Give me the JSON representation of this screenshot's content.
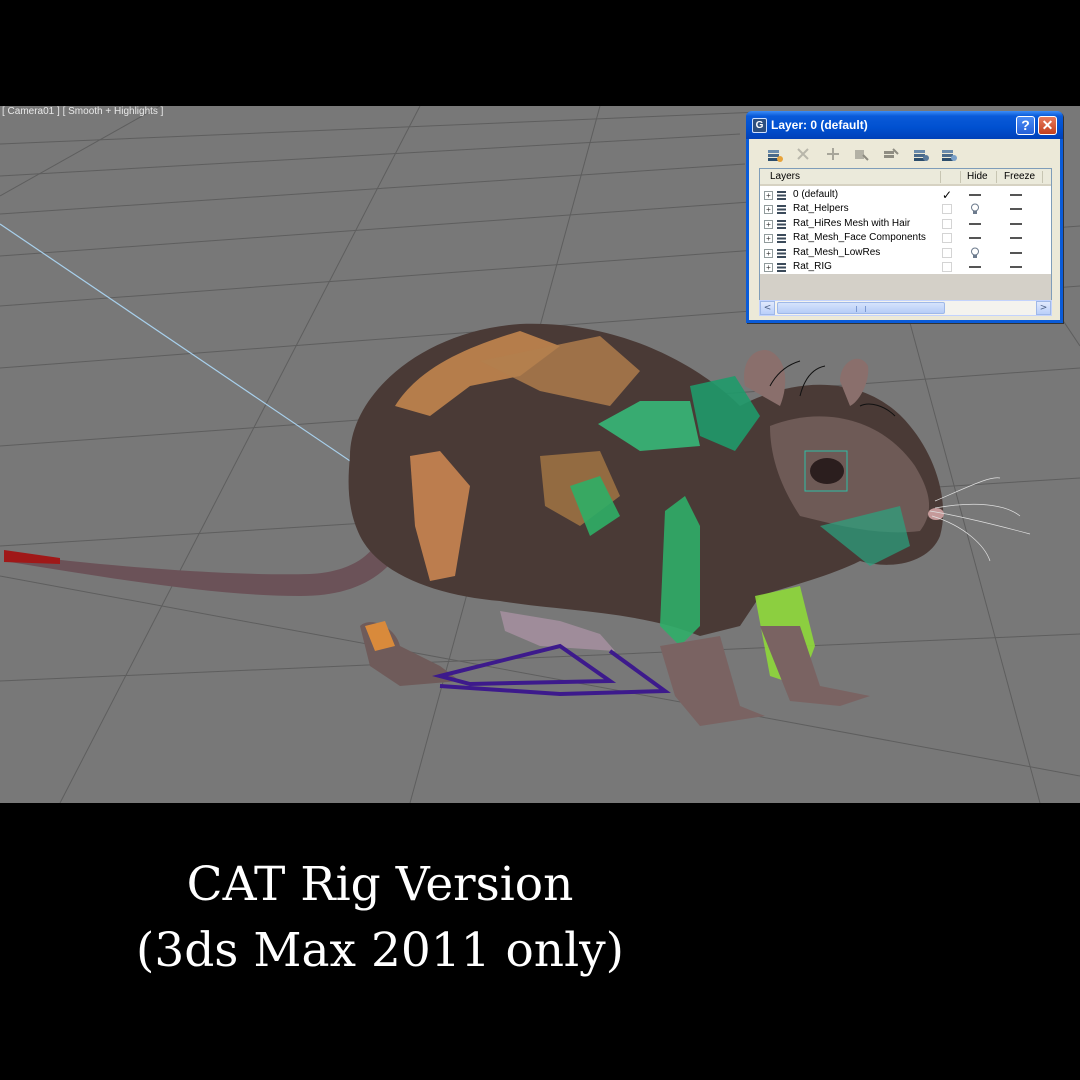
{
  "viewport": {
    "label": "[ Camera01 ] [ Smooth + Highlights ]"
  },
  "layer_dialog": {
    "title": "Layer: 0 (default)",
    "help_button": "?",
    "close_button": "✕",
    "toolbar": [
      "create-layer-icon",
      "delete-layer-icon",
      "add-selection-icon",
      "select-objects-icon",
      "highlight-layer-icon",
      "hide-all-icon",
      "freeze-all-icon"
    ],
    "columns": {
      "layers": "Layers",
      "hide": "Hide",
      "freeze": "Freeze"
    },
    "layers": [
      {
        "name": "0 (default)",
        "current": true,
        "hidden": false
      },
      {
        "name": "Rat_Helpers",
        "current": false,
        "hidden": true
      },
      {
        "name": "Rat_HiRes Mesh with Hair",
        "current": false,
        "hidden": false
      },
      {
        "name": "Rat_Mesh_Face Components",
        "current": false,
        "hidden": false
      },
      {
        "name": "Rat_Mesh_LowRes",
        "current": false,
        "hidden": true
      },
      {
        "name": "Rat_RIG",
        "current": false,
        "hidden": false
      }
    ],
    "current_mark": "✓",
    "expander": "+",
    "scroll_left": "<",
    "scroll_right": ">"
  },
  "caption": {
    "line1": "CAT Rig Version",
    "line2": "(3ds Max 2011 only)"
  }
}
